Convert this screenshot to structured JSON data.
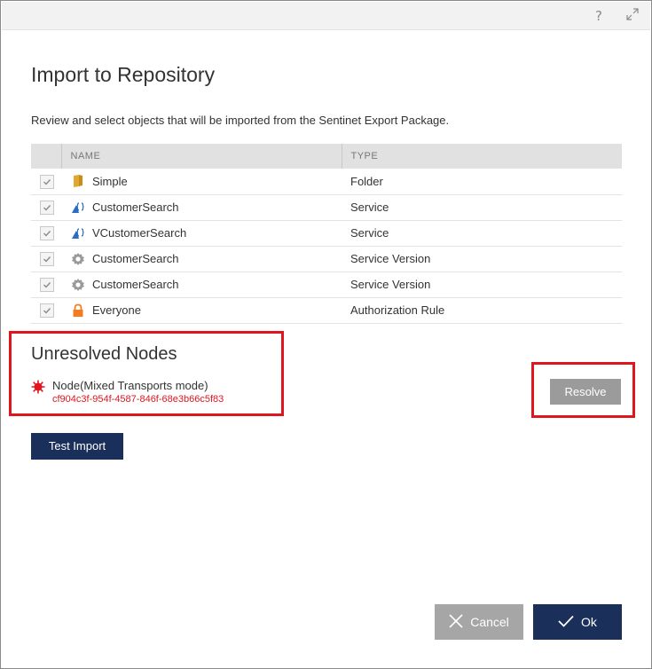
{
  "titlebar": {
    "help_glyph": "?",
    "expand_icon": "expand-icon"
  },
  "dialog": {
    "title": "Import to Repository",
    "subtitle": "Review and select objects that will be imported from the Sentinet Export Package."
  },
  "table": {
    "columns": [
      "NAME",
      "TYPE"
    ],
    "rows": [
      {
        "checked": true,
        "icon": "folder-icon",
        "name": "Simple",
        "type": "Folder"
      },
      {
        "checked": true,
        "icon": "service-icon",
        "name": "CustomerSearch",
        "type": "Service"
      },
      {
        "checked": true,
        "icon": "service-icon",
        "name": "VCustomerSearch",
        "type": "Service"
      },
      {
        "checked": true,
        "icon": "gear-icon",
        "name": "CustomerSearch",
        "type": "Service Version"
      },
      {
        "checked": true,
        "icon": "gear-icon",
        "name": "CustomerSearch",
        "type": "Service Version"
      },
      {
        "checked": true,
        "icon": "lock-icon",
        "name": "Everyone",
        "type": "Authorization Rule"
      }
    ]
  },
  "unresolved": {
    "title": "Unresolved Nodes",
    "node_name": "Node(Mixed Transports mode)",
    "node_id": "cf904c3f-954f-4587-846f-68e3b66c5f83",
    "resolve_label": "Resolve"
  },
  "buttons": {
    "test_import": "Test Import",
    "cancel": "Cancel",
    "ok": "Ok"
  },
  "colors": {
    "accent_dark_blue": "#1b2f5b",
    "highlight_red": "#e0161f",
    "disabled_gray": "#9b9b9b",
    "folder_gold": "#e0a82e",
    "lock_orange": "#f47b20"
  }
}
